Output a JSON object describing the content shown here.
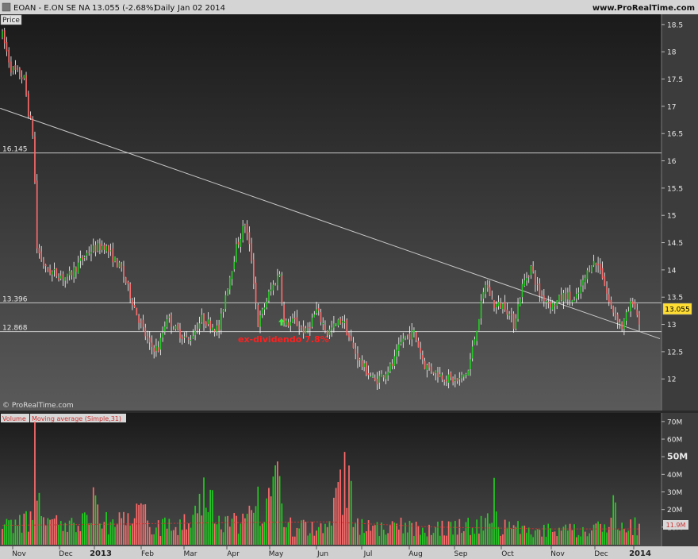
{
  "header": {
    "symbol_line": "EOAN - E.ON SE NA",
    "last_price": "13.055 (-2.68%)",
    "period": "Daily",
    "date": "Jan 02 2014",
    "site": "www.ProRealTime.com"
  },
  "price_panel": {
    "label": "Price",
    "watermark": "© ProRealTime.com",
    "annotation": "ex-dividendo 7.8%",
    "last_price_tag": "13.055"
  },
  "volume_panel": {
    "label_volume": "Volume",
    "label_ma": "Moving average (Simple,31)",
    "last_volume_tag": "11.9M"
  },
  "colors": {
    "up": "#22cc22",
    "down": "#ff6b6b",
    "wick": "#ffffff",
    "annotation": "#ff2020",
    "marker": "#44ee44",
    "tag_bg": "#ffdd33",
    "ma": "#cc3333"
  },
  "chart_data": {
    "type": "candlestick",
    "price_axis": {
      "ylim": [
        11.45,
        18.6
      ],
      "ticks": [
        "18.5",
        "18",
        "17.5",
        "17",
        "16.5",
        "16",
        "15.5",
        "15",
        "14.5",
        "14",
        "13.5",
        "13",
        "12.5",
        "12"
      ]
    },
    "volume_axis": {
      "ylim": [
        0,
        74
      ],
      "ticks": [
        "70M",
        "60M",
        "50M",
        "40M",
        "30M",
        "20M",
        "10M"
      ]
    },
    "x_axis_labels": [
      "Nov",
      "Dec",
      "2013",
      "Feb",
      "Mar",
      "Apr",
      "May",
      "Jun",
      "Jul",
      "Aug",
      "Sep",
      "Oct",
      "Nov",
      "Dec",
      "2014"
    ],
    "horizontal_levels": [
      {
        "label": "16.145",
        "value": 16.145
      },
      {
        "label": "13.396",
        "value": 13.396
      },
      {
        "label": "12.868",
        "value": 12.868
      }
    ],
    "trendline": {
      "start": {
        "index": 0,
        "price": 16.95
      },
      "end": {
        "index": 294,
        "price": 12.87
      }
    },
    "anchors_price": [
      [
        0,
        18.3
      ],
      [
        4,
        17.7
      ],
      [
        10,
        17.5
      ],
      [
        12,
        16.9
      ],
      [
        14,
        16.5
      ],
      [
        15,
        15.6
      ],
      [
        16,
        14.4
      ],
      [
        20,
        14.0
      ],
      [
        30,
        13.85
      ],
      [
        40,
        14.35
      ],
      [
        47,
        14.45
      ],
      [
        55,
        14.0
      ],
      [
        62,
        13.2
      ],
      [
        68,
        12.6
      ],
      [
        72,
        12.55
      ],
      [
        76,
        13.15
      ],
      [
        80,
        12.9
      ],
      [
        86,
        12.7
      ],
      [
        92,
        13.1
      ],
      [
        100,
        12.9
      ],
      [
        103,
        13.55
      ],
      [
        108,
        14.4
      ],
      [
        112,
        14.85
      ],
      [
        115,
        14.2
      ],
      [
        118,
        13.0
      ],
      [
        123,
        13.55
      ],
      [
        128,
        13.95
      ],
      [
        130,
        13.0
      ],
      [
        135,
        13.05
      ],
      [
        140,
        12.85
      ],
      [
        145,
        13.25
      ],
      [
        150,
        12.85
      ],
      [
        157,
        13.1
      ],
      [
        162,
        12.55
      ],
      [
        166,
        12.25
      ],
      [
        172,
        11.95
      ],
      [
        180,
        12.25
      ],
      [
        185,
        12.75
      ],
      [
        190,
        12.85
      ],
      [
        195,
        12.25
      ],
      [
        203,
        12.05
      ],
      [
        210,
        11.95
      ],
      [
        215,
        12.15
      ],
      [
        220,
        13.15
      ],
      [
        223,
        13.75
      ],
      [
        227,
        13.35
      ],
      [
        232,
        13.35
      ],
      [
        236,
        13.0
      ],
      [
        240,
        13.7
      ],
      [
        244,
        14.05
      ],
      [
        248,
        13.55
      ],
      [
        254,
        13.35
      ],
      [
        260,
        13.55
      ],
      [
        264,
        13.4
      ],
      [
        268,
        13.75
      ],
      [
        272,
        14.15
      ],
      [
        276,
        14.05
      ],
      [
        280,
        13.4
      ],
      [
        286,
        12.95
      ],
      [
        288,
        13.15
      ],
      [
        291,
        13.45
      ],
      [
        294,
        13.05
      ]
    ],
    "anchors_volume": [
      [
        0,
        9
      ],
      [
        14,
        14
      ],
      [
        15,
        70
      ],
      [
        16,
        25
      ],
      [
        20,
        11
      ],
      [
        40,
        12
      ],
      [
        43,
        28
      ],
      [
        45,
        12
      ],
      [
        60,
        12
      ],
      [
        66,
        23
      ],
      [
        68,
        10
      ],
      [
        80,
        10
      ],
      [
        97,
        31
      ],
      [
        98,
        12
      ],
      [
        110,
        12
      ],
      [
        118,
        33
      ],
      [
        120,
        12
      ],
      [
        128,
        39
      ],
      [
        130,
        10
      ],
      [
        150,
        10
      ],
      [
        160,
        45
      ],
      [
        162,
        10
      ],
      [
        200,
        10
      ],
      [
        225,
        12
      ],
      [
        227,
        38
      ],
      [
        229,
        10
      ],
      [
        258,
        8
      ],
      [
        280,
        10
      ],
      [
        283,
        24
      ],
      [
        285,
        8
      ],
      [
        294,
        11.9
      ]
    ],
    "volume_ma": [
      [
        0,
        11
      ],
      [
        40,
        11.5
      ],
      [
        100,
        12.5
      ],
      [
        150,
        13
      ],
      [
        200,
        10
      ],
      [
        250,
        9
      ],
      [
        294,
        9
      ]
    ],
    "n_sessions": 295
  }
}
